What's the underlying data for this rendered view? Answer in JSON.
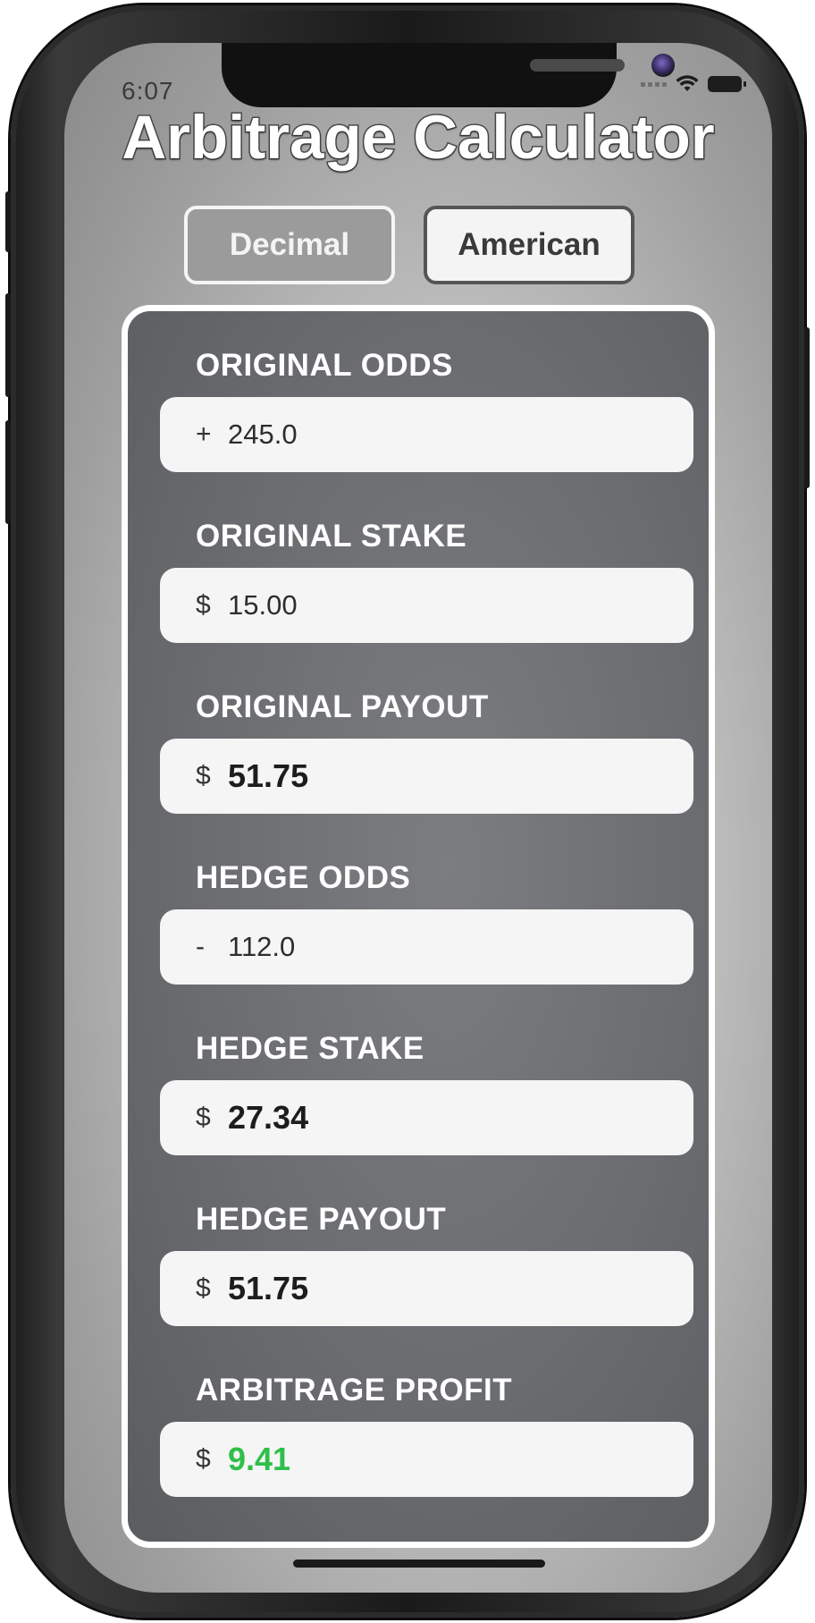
{
  "status": {
    "time": "6:07"
  },
  "app": {
    "title": "Arbitrage Calculator"
  },
  "mode": {
    "options": [
      "Decimal",
      "American"
    ],
    "selected": "American"
  },
  "fields": {
    "original_odds": {
      "label": "ORIGINAL ODDS",
      "prefix": "+",
      "value": "245.0"
    },
    "original_stake": {
      "label": "ORIGINAL STAKE",
      "prefix": "$",
      "value": "15.00"
    },
    "original_payout": {
      "label": "ORIGINAL PAYOUT",
      "prefix": "$",
      "value": "51.75"
    },
    "hedge_odds": {
      "label": "HEDGE ODDS",
      "prefix": "-",
      "value": "112.0"
    },
    "hedge_stake": {
      "label": "HEDGE STAKE",
      "prefix": "$",
      "value": "27.34"
    },
    "hedge_payout": {
      "label": "HEDGE PAYOUT",
      "prefix": "$",
      "value": "51.75"
    },
    "arbitrage_profit": {
      "label": "ARBITRAGE PROFIT",
      "prefix": "$",
      "value": "9.41"
    }
  },
  "colors": {
    "profit": "#2fbf4a",
    "card_background": "#6a6c70",
    "field_background": "#f5f5f5"
  },
  "icons": [
    "cellular-signal-icon",
    "wifi-icon",
    "battery-icon"
  ]
}
